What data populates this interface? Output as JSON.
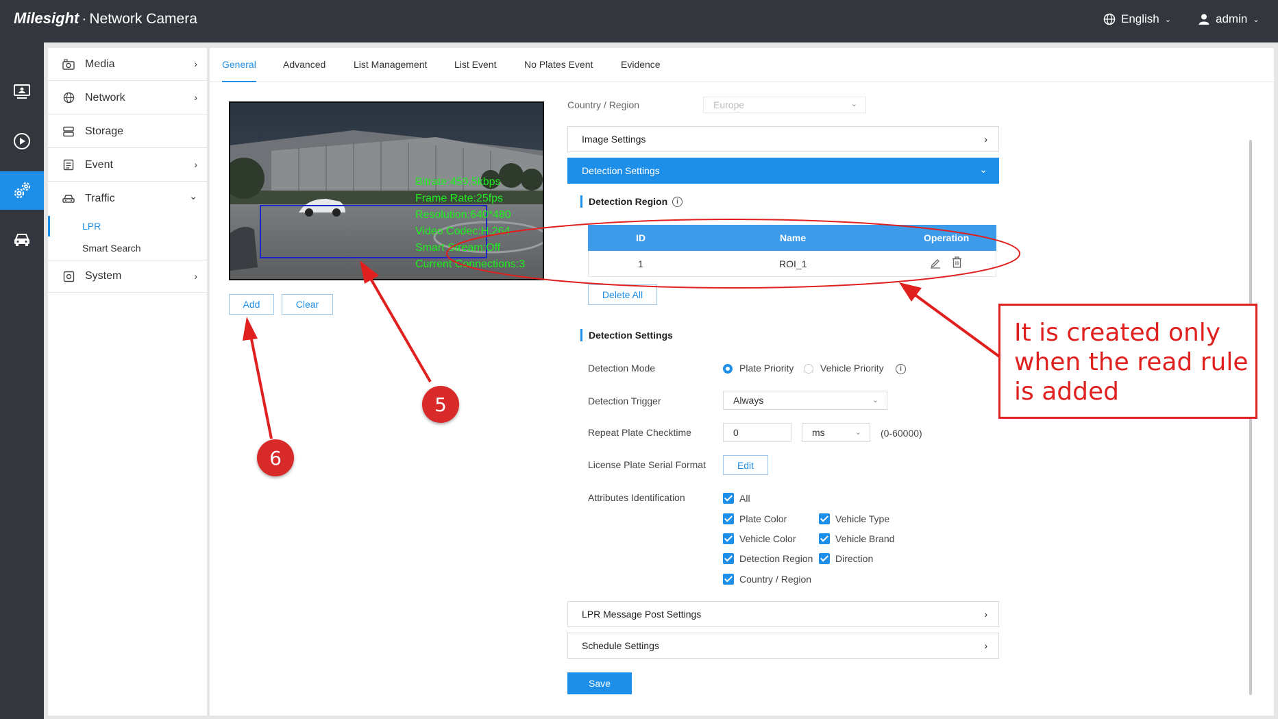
{
  "header": {
    "brand_logo": "Milesight",
    "brand_title": "Network Camera",
    "language": "English",
    "user": "admin"
  },
  "iconnav": {
    "items": [
      "live-view-icon",
      "playback-icon",
      "settings-icon",
      "vehicle-icon"
    ],
    "active": "settings-icon"
  },
  "menu": {
    "items": [
      {
        "label": "Media",
        "icon": "media-icon",
        "arrow": "›"
      },
      {
        "label": "Network",
        "icon": "globe-icon",
        "arrow": "›"
      },
      {
        "label": "Storage",
        "icon": "storage-icon",
        "arrow": ""
      },
      {
        "label": "Event",
        "icon": "event-icon",
        "arrow": "›"
      },
      {
        "label": "Traffic",
        "icon": "car-icon",
        "arrow": "⌄"
      },
      {
        "label": "System",
        "icon": "system-icon",
        "arrow": "›"
      }
    ],
    "traffic_sub": [
      {
        "label": "LPR",
        "active": true
      },
      {
        "label": "Smart Search",
        "active": false
      }
    ]
  },
  "tabs": [
    {
      "label": "General",
      "active": true
    },
    {
      "label": "Advanced",
      "active": false
    },
    {
      "label": "List Management",
      "active": false
    },
    {
      "label": "List Event",
      "active": false
    },
    {
      "label": "No Plates Event",
      "active": false
    },
    {
      "label": "Evidence",
      "active": false
    }
  ],
  "video": {
    "osd": [
      "Bitrate:459.5kbps",
      "Frame Rate:25fps",
      "Resolution:640*480",
      "Video Codec:H.264",
      "Smart Stream:Off",
      "Current Connections:3"
    ],
    "add_label": "Add",
    "clear_label": "Clear"
  },
  "settings": {
    "country_label": "Country / Region",
    "country_value": "Europe",
    "image_settings": "Image Settings",
    "detection_settings_header": "Detection Settings",
    "detection_region_title": "Detection Region",
    "region_table": {
      "columns": [
        "ID",
        "Name",
        "Operation"
      ],
      "rows": [
        {
          "id": "1",
          "name": "ROI_1"
        }
      ]
    },
    "delete_all": "Delete All",
    "detection_settings_title": "Detection Settings",
    "detection_mode_label": "Detection Mode",
    "mode_options": [
      {
        "label": "Plate Priority",
        "checked": true
      },
      {
        "label": "Vehicle Priority",
        "checked": false
      }
    ],
    "trigger_label": "Detection Trigger",
    "trigger_value": "Always",
    "checktime_label": "Repeat Plate Checktime",
    "checktime_value": "0",
    "checktime_unit": "ms",
    "checktime_range": "(0-60000)",
    "serial_label": "License Plate Serial Format",
    "serial_button": "Edit",
    "attributes_label": "Attributes Identification",
    "attributes": {
      "all": "All",
      "plate_color": "Plate Color",
      "vehicle_type": "Vehicle Type",
      "vehicle_color": "Vehicle Color",
      "vehicle_brand": "Vehicle Brand",
      "detection_region": "Detection Region",
      "direction": "Direction",
      "country_region": "Country / Region"
    },
    "lpr_post": "LPR Message Post Settings",
    "schedule": "Schedule Settings",
    "save": "Save"
  },
  "annotations": {
    "callout": "It is created only\nwhen the read rule\nis added",
    "marker_5": "5",
    "marker_6": "6",
    "color": "#e0201e"
  },
  "colors": {
    "accent": "#1e8fe8",
    "topbar": "#33373d",
    "osd": "#1ef01e"
  }
}
